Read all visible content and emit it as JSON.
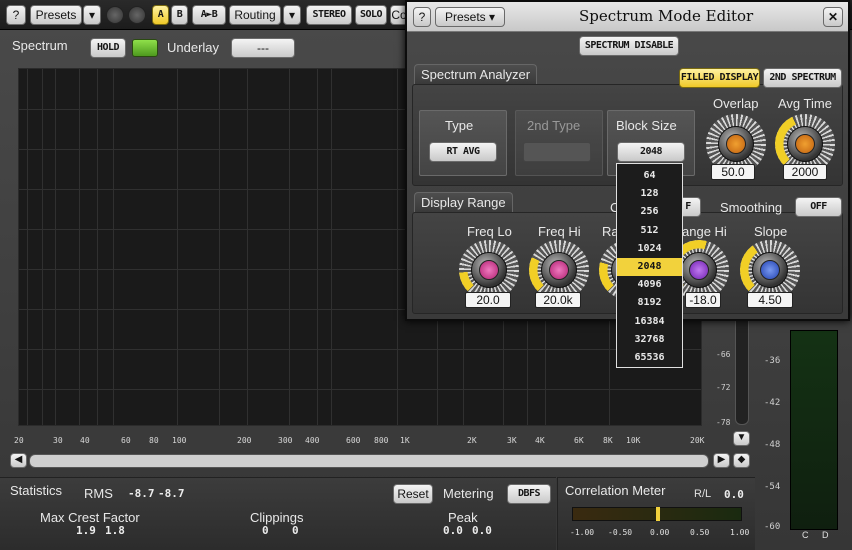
{
  "toolbar": {
    "help": "?",
    "presets": "Presets",
    "a": "A",
    "b": "B",
    "ab": "A►B",
    "routing": "Routing",
    "stereo": "STEREO",
    "solo": "SOLO",
    "cut": "Co"
  },
  "spectrum": {
    "title": "Spectrum",
    "hold": "HOLD",
    "underlay": "Underlay",
    "underlay_value": "---",
    "freq_labels": [
      "20",
      "30",
      "40",
      "60",
      "80",
      "100",
      "200",
      "300",
      "400",
      "600",
      "800",
      "1K",
      "2K",
      "3K",
      "4K",
      "6K",
      "8K",
      "10K",
      "20K"
    ],
    "db_labels": [
      "-66",
      "-72",
      "-78"
    ]
  },
  "meter": {
    "labels": [
      "-36",
      "-42",
      "-48",
      "-54",
      "-60"
    ],
    "channels": [
      "C",
      "D"
    ]
  },
  "statistics": {
    "title": "Statistics",
    "rms_label": "RMS",
    "rms_l": "-8.7",
    "rms_r": "-8.7",
    "reset": "Reset",
    "metering": "Metering",
    "metering_value": "DBFS",
    "max_crest_label": "Max Crest Factor",
    "max_crest_l": "1.9",
    "max_crest_r": "1.8",
    "clippings_label": "Clippings",
    "clippings_l": "0",
    "clippings_r": "0",
    "peak_label": "Peak",
    "peak_l": "0.0",
    "peak_r": "0.0"
  },
  "correlation": {
    "title": "Correlation Meter",
    "rl": "R/L",
    "rl_value": "0.0",
    "scale": [
      "-1.00",
      "-0.50",
      "0.00",
      "0.50",
      "1.00"
    ]
  },
  "editor": {
    "help": "?",
    "presets": "Presets ▾",
    "title": "Spectrum Mode Editor",
    "close": "✕",
    "disable": "SPECTRUM DISABLE",
    "analyzer_tab": "Spectrum Analyzer",
    "filled_display": "FILLED DISPLAY",
    "second_spectrum": "2ND SPECTRUM",
    "type_label": "Type",
    "type_value": "RT AVG",
    "type2_label": "2nd Type",
    "block_label": "Block Size",
    "block_value": "2048",
    "overlap_label": "Overlap",
    "overlap_value": "50.0",
    "avg_label": "Avg Time",
    "avg_value": "2000",
    "range_tab": "Display Range",
    "channel_label": "C",
    "channel_value": "F",
    "smoothing_label": "Smoothing",
    "smoothing_value": "OFF",
    "freq_lo_label": "Freq Lo",
    "freq_lo_value": "20.0",
    "freq_hi_label": "Freq Hi",
    "freq_hi_value": "20.0k",
    "range_lo_label": "Ra",
    "range_hi_label": "ange Hi",
    "range_hi_value": "-18.0",
    "slope_label": "Slope",
    "slope_value": "4.50"
  },
  "block_options": [
    "64",
    "128",
    "256",
    "512",
    "1024",
    "2048",
    "4096",
    "8192",
    "16384",
    "32768",
    "65536"
  ],
  "block_selected": "2048",
  "colors": {
    "accent": "#f2d23c",
    "pink": "#d94a9a",
    "orange": "#e08a1e",
    "purple": "#9a4ad0",
    "blue": "#4a6ad8"
  }
}
